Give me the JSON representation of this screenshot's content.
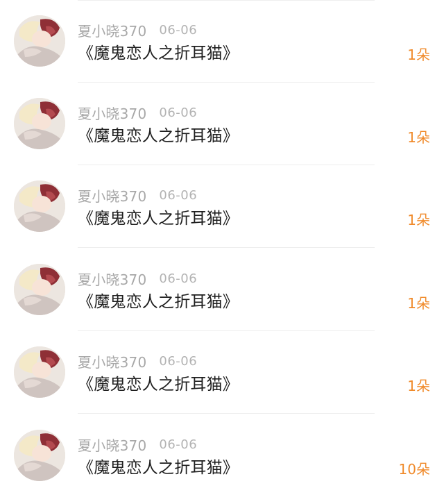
{
  "colors": {
    "count_accent": "#f08a2a",
    "username": "#a8a8a8",
    "title": "#1e1e1e"
  },
  "items": [
    {
      "avatar": "avatar-anime-image",
      "username": "夏小晓370",
      "date": "06-06",
      "title": "《魔鬼恋人之折耳猫》",
      "count": "1朵"
    },
    {
      "avatar": "avatar-anime-image",
      "username": "夏小晓370",
      "date": "06-06",
      "title": "《魔鬼恋人之折耳猫》",
      "count": "1朵"
    },
    {
      "avatar": "avatar-anime-image",
      "username": "夏小晓370",
      "date": "06-06",
      "title": "《魔鬼恋人之折耳猫》",
      "count": "1朵"
    },
    {
      "avatar": "avatar-anime-image",
      "username": "夏小晓370",
      "date": "06-06",
      "title": "《魔鬼恋人之折耳猫》",
      "count": "1朵"
    },
    {
      "avatar": "avatar-anime-image",
      "username": "夏小晓370",
      "date": "06-06",
      "title": "《魔鬼恋人之折耳猫》",
      "count": "1朵"
    },
    {
      "avatar": "avatar-anime-image",
      "username": "夏小晓370",
      "date": "06-06",
      "title": "《魔鬼恋人之折耳猫》",
      "count": "10朵"
    }
  ]
}
